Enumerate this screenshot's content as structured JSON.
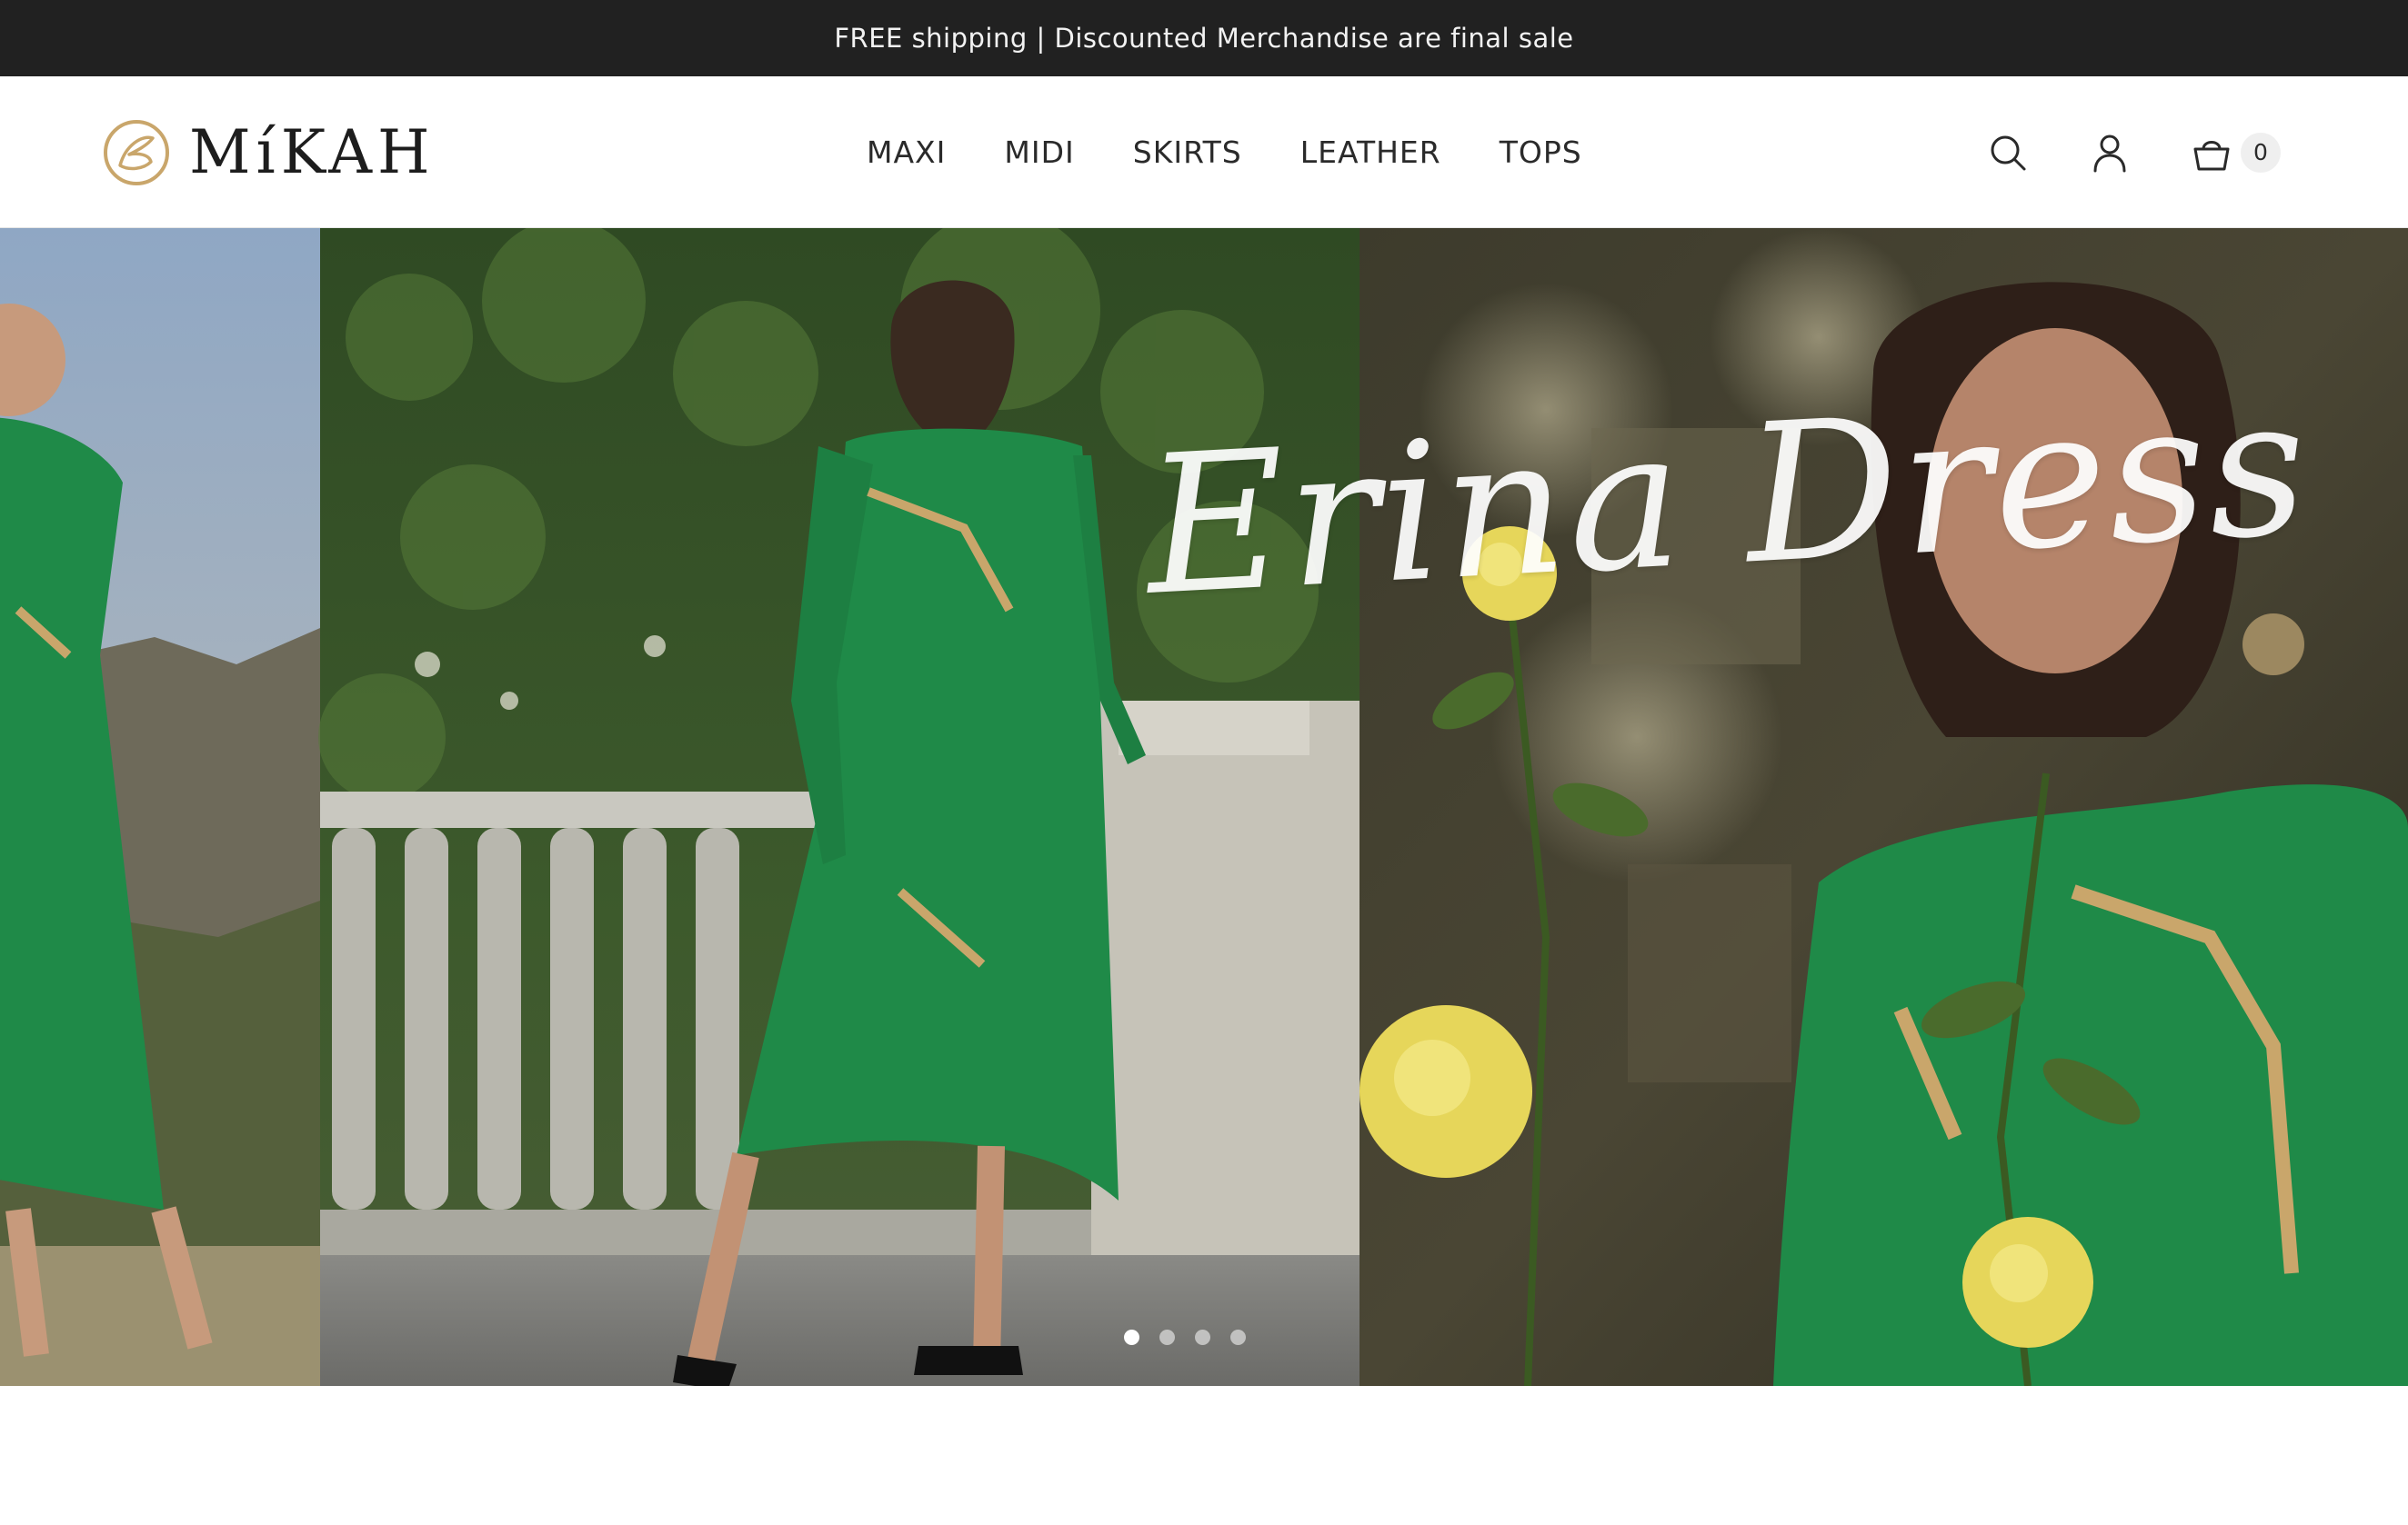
{
  "announcement": {
    "text": "FREE shipping | Discounted Merchandise are final sale"
  },
  "header": {
    "logo_text": "MíKAH",
    "nav": [
      {
        "label": "MAXI"
      },
      {
        "label": "MIDI"
      },
      {
        "label": "SKIRTS"
      },
      {
        "label": "LEATHER"
      },
      {
        "label": "TOPS"
      }
    ],
    "icons": {
      "search": "search-icon",
      "account": "user-icon",
      "cart": "shopping-bag-icon"
    },
    "cart_count": "0"
  },
  "hero": {
    "title": "Erina Dress",
    "slide_count": 4,
    "active_slide": 1
  },
  "colors": {
    "announcement_bg": "#212121",
    "dress_green": "#1f8a48",
    "logo_gold": "#c9a66b"
  }
}
